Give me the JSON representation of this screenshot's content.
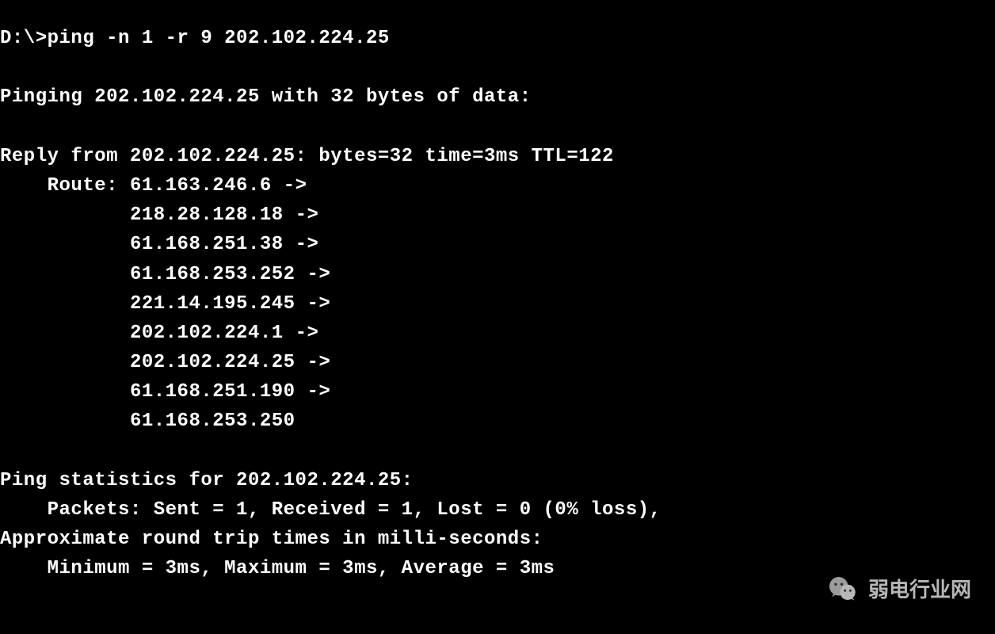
{
  "prompt": "D:\\>",
  "command": "ping -n 1 -r 9 202.102.224.25",
  "pinging_line": "Pinging 202.102.224.25 with 32 bytes of data:",
  "reply_line": "Reply from 202.102.224.25: bytes=32 time=3ms TTL=122",
  "route_label": "    Route: ",
  "route_indent": "           ",
  "route_hops": [
    "61.163.246.6 ->",
    "218.28.128.18 ->",
    "61.168.251.38 ->",
    "61.168.253.252 ->",
    "221.14.195.245 ->",
    "202.102.224.1 ->",
    "202.102.224.25 ->",
    "61.168.251.190 ->",
    "61.168.253.250"
  ],
  "stats_header": "Ping statistics for 202.102.224.25:",
  "packets_line": "    Packets: Sent = 1, Received = 1, Lost = 0 (0% loss),",
  "approx_line": "Approximate round trip times in milli-seconds:",
  "minmax_line": "    Minimum = 3ms, Maximum = 3ms, Average = 3ms",
  "watermark_text": "弱电行业网"
}
